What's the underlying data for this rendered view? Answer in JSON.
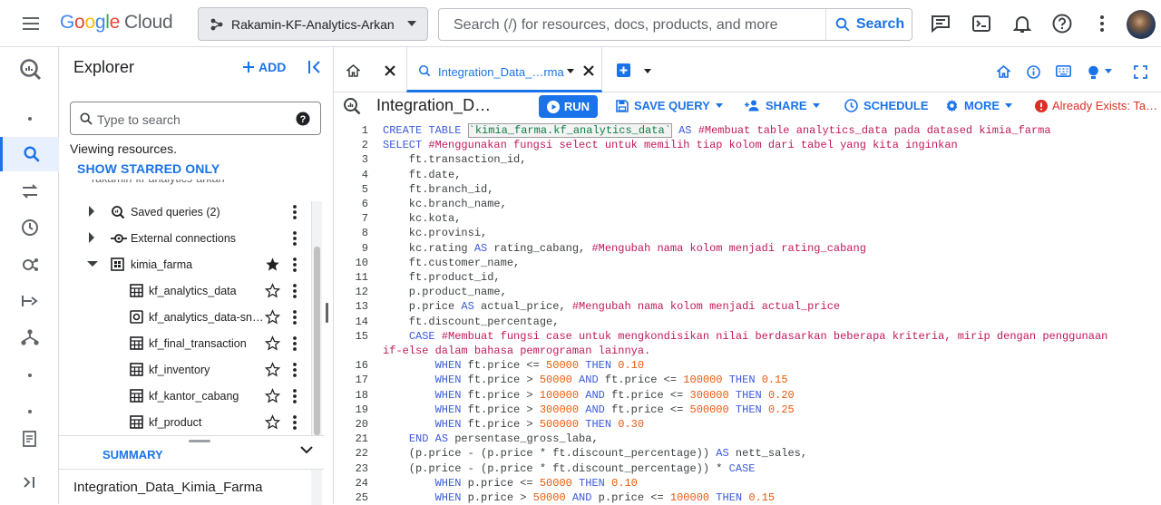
{
  "topbar": {
    "logo_google": "Google",
    "logo_cloud": "Cloud",
    "project_name": "Rakamin-KF-Analytics-Arkan",
    "search_placeholder": "Search (/) for resources, docs, products, and more",
    "search_button": "Search",
    "icons": [
      "menu-icon",
      "project-icon",
      "search-icon",
      "notes-icon",
      "terminal-icon",
      "bell-icon",
      "help-icon",
      "more-vert-icon",
      "avatar"
    ]
  },
  "left_rail": {
    "icons": [
      "bigquery-logo-icon",
      "search-icon",
      "transfer-icon",
      "history-icon",
      "analytics-hub-icon",
      "pipeline-icon",
      "graph-icon",
      "notes-icon",
      "expand-icon"
    ]
  },
  "explorer": {
    "title": "Explorer",
    "add_label": "ADD",
    "search_placeholder": "Type to search",
    "viewing": "Viewing resources.",
    "show_starred": "SHOW STARRED ONLY",
    "partial_project": "rakamin-kf-analytics-arkan",
    "items": [
      {
        "label": "Saved queries (2)",
        "level": 1,
        "icon": "saved-query-icon",
        "arrow": "right"
      },
      {
        "label": "External connections",
        "level": 1,
        "icon": "connection-icon",
        "arrow": "right"
      },
      {
        "label": "kimia_farma",
        "level": 1,
        "icon": "dataset-icon",
        "arrow": "down",
        "starred": true
      },
      {
        "label": "kf_analytics_data",
        "level": 2,
        "icon": "table-icon"
      },
      {
        "label": "kf_analytics_data-sn…",
        "level": 2,
        "icon": "snapshot-icon"
      },
      {
        "label": "kf_final_transaction",
        "level": 2,
        "icon": "table-icon"
      },
      {
        "label": "kf_inventory",
        "level": 2,
        "icon": "table-icon"
      },
      {
        "label": "kf_kantor_cabang",
        "level": 2,
        "icon": "table-icon"
      },
      {
        "label": "kf_product",
        "level": 2,
        "icon": "table-icon"
      }
    ],
    "summary_label": "SUMMARY",
    "summary_name": "Integration_Data_Kimia_Farma"
  },
  "tabs": {
    "active_label": "Integration_Data_…rma"
  },
  "query_toolbar": {
    "title": "Integration_D…",
    "run": "RUN",
    "save_query": "SAVE QUERY",
    "share": "SHARE",
    "schedule": "SCHEDULE",
    "more": "MORE",
    "error": "Already Exists: Ta…"
  },
  "colors": {
    "accent": "#1a73e8",
    "keyword": "#3b5bdb",
    "comment": "#c2185b",
    "number": "#e8590c",
    "string": "#0b8043",
    "error": "#d93025"
  },
  "code": [
    {
      "n": "1",
      "tokens": [
        [
          "k",
          "CREATE TABLE "
        ],
        [
          "str",
          "`kimia_farma.kf_analytics_data`"
        ],
        [
          "k",
          " AS "
        ],
        [
          "c",
          "#Membuat table analytics_data pada datased kimia_farma"
        ]
      ]
    },
    {
      "n": "2",
      "tokens": [
        [
          "k",
          "SELECT "
        ],
        [
          "c",
          "#Menggunakan fungsi select untuk memilih tiap kolom dari tabel yang kita inginkan"
        ]
      ]
    },
    {
      "n": "3",
      "tokens": [
        [
          "t",
          "    ft.transaction_id,"
        ]
      ]
    },
    {
      "n": "4",
      "tokens": [
        [
          "t",
          "    ft.date,"
        ]
      ]
    },
    {
      "n": "5",
      "tokens": [
        [
          "t",
          "    ft.branch_id,"
        ]
      ]
    },
    {
      "n": "6",
      "tokens": [
        [
          "t",
          "    kc.branch_name,"
        ]
      ]
    },
    {
      "n": "7",
      "tokens": [
        [
          "t",
          "    kc.kota,"
        ]
      ]
    },
    {
      "n": "8",
      "tokens": [
        [
          "t",
          "    kc.provinsi,"
        ]
      ]
    },
    {
      "n": "9",
      "tokens": [
        [
          "t",
          "    kc.rating "
        ],
        [
          "k",
          "AS"
        ],
        [
          "t",
          " rating_cabang, "
        ],
        [
          "c",
          "#Mengubah nama kolom menjadi rating_cabang"
        ]
      ]
    },
    {
      "n": "10",
      "tokens": [
        [
          "t",
          "    ft.customer_name,"
        ]
      ]
    },
    {
      "n": "11",
      "tokens": [
        [
          "t",
          "    ft.product_id,"
        ]
      ]
    },
    {
      "n": "12",
      "tokens": [
        [
          "t",
          "    p.product_name,"
        ]
      ]
    },
    {
      "n": "13",
      "tokens": [
        [
          "t",
          "    p.price "
        ],
        [
          "k",
          "AS"
        ],
        [
          "t",
          " actual_price, "
        ],
        [
          "c",
          "#Mengubah nama kolom menjadi actual_price"
        ]
      ]
    },
    {
      "n": "14",
      "tokens": [
        [
          "t",
          "    ft.discount_percentage,"
        ]
      ]
    },
    {
      "n": "15",
      "tokens": [
        [
          "t",
          "    "
        ],
        [
          "k",
          "CASE "
        ],
        [
          "c",
          "#Membuat fungsi case untuk mengkondisikan nilai berdasarkan beberapa kriteria, mirip dengan penggunaan"
        ]
      ]
    },
    {
      "n": "",
      "tokens": [
        [
          "c",
          "if-else dalam bahasa pemrograman lainnya."
        ]
      ]
    },
    {
      "n": "16",
      "tokens": [
        [
          "t",
          "        "
        ],
        [
          "k",
          "WHEN"
        ],
        [
          "t",
          " ft.price <= "
        ],
        [
          "n",
          "50000"
        ],
        [
          "k",
          " THEN "
        ],
        [
          "n",
          "0.10"
        ]
      ]
    },
    {
      "n": "17",
      "tokens": [
        [
          "t",
          "        "
        ],
        [
          "k",
          "WHEN"
        ],
        [
          "t",
          " ft.price > "
        ],
        [
          "n",
          "50000"
        ],
        [
          "k",
          " AND "
        ],
        [
          "t",
          "ft.price <= "
        ],
        [
          "n",
          "100000"
        ],
        [
          "k",
          " THEN "
        ],
        [
          "n",
          "0.15"
        ]
      ]
    },
    {
      "n": "18",
      "tokens": [
        [
          "t",
          "        "
        ],
        [
          "k",
          "WHEN"
        ],
        [
          "t",
          " ft.price > "
        ],
        [
          "n",
          "100000"
        ],
        [
          "k",
          " AND "
        ],
        [
          "t",
          "ft.price <= "
        ],
        [
          "n",
          "300000"
        ],
        [
          "k",
          " THEN "
        ],
        [
          "n",
          "0.20"
        ]
      ]
    },
    {
      "n": "19",
      "tokens": [
        [
          "t",
          "        "
        ],
        [
          "k",
          "WHEN"
        ],
        [
          "t",
          " ft.price > "
        ],
        [
          "n",
          "300000"
        ],
        [
          "k",
          " AND "
        ],
        [
          "t",
          "ft.price <= "
        ],
        [
          "n",
          "500000"
        ],
        [
          "k",
          " THEN "
        ],
        [
          "n",
          "0.25"
        ]
      ]
    },
    {
      "n": "20",
      "tokens": [
        [
          "t",
          "        "
        ],
        [
          "k",
          "WHEN"
        ],
        [
          "t",
          " ft.price > "
        ],
        [
          "n",
          "500000"
        ],
        [
          "k",
          " THEN "
        ],
        [
          "n",
          "0.30"
        ]
      ]
    },
    {
      "n": "21",
      "tokens": [
        [
          "t",
          "    "
        ],
        [
          "k",
          "END AS"
        ],
        [
          "t",
          " persentase_gross_laba,"
        ]
      ]
    },
    {
      "n": "22",
      "tokens": [
        [
          "t",
          "    (p.price - (p.price * ft.discount_percentage)) "
        ],
        [
          "k",
          "AS"
        ],
        [
          "t",
          " nett_sales,"
        ]
      ]
    },
    {
      "n": "23",
      "tokens": [
        [
          "t",
          "    (p.price - (p.price * ft.discount_percentage)) * "
        ],
        [
          "k",
          "CASE"
        ]
      ]
    },
    {
      "n": "24",
      "tokens": [
        [
          "t",
          "        "
        ],
        [
          "k",
          "WHEN"
        ],
        [
          "t",
          " p.price <= "
        ],
        [
          "n",
          "50000"
        ],
        [
          "k",
          " THEN "
        ],
        [
          "n",
          "0.10"
        ]
      ]
    },
    {
      "n": "25",
      "tokens": [
        [
          "t",
          "        "
        ],
        [
          "k",
          "WHEN"
        ],
        [
          "t",
          " p.price > "
        ],
        [
          "n",
          "50000"
        ],
        [
          "k",
          " AND "
        ],
        [
          "t",
          "p.price <= "
        ],
        [
          "n",
          "100000"
        ],
        [
          "k",
          " THEN "
        ],
        [
          "n",
          "0.15"
        ]
      ]
    }
  ]
}
